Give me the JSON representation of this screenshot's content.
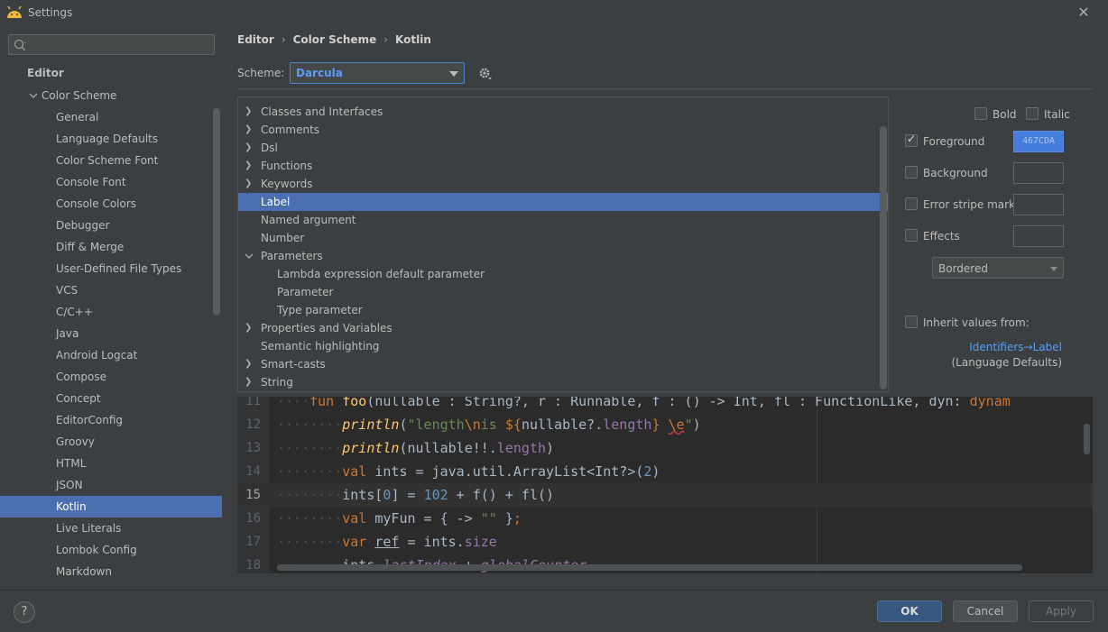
{
  "window": {
    "title": "Settings"
  },
  "search": {
    "placeholder": "",
    "value": ""
  },
  "sidebar": {
    "items": [
      {
        "label": "Editor",
        "level": 0
      },
      {
        "label": "Color Scheme",
        "level": 1,
        "expanded": true
      },
      {
        "label": "General",
        "level": 2
      },
      {
        "label": "Language Defaults",
        "level": 2
      },
      {
        "label": "Color Scheme Font",
        "level": 2
      },
      {
        "label": "Console Font",
        "level": 2
      },
      {
        "label": "Console Colors",
        "level": 2
      },
      {
        "label": "Debugger",
        "level": 2
      },
      {
        "label": "Diff & Merge",
        "level": 2
      },
      {
        "label": "User-Defined File Types",
        "level": 2
      },
      {
        "label": "VCS",
        "level": 2
      },
      {
        "label": "C/C++",
        "level": 2
      },
      {
        "label": "Java",
        "level": 2
      },
      {
        "label": "Android Logcat",
        "level": 2
      },
      {
        "label": "Compose",
        "level": 2
      },
      {
        "label": "Concept",
        "level": 2
      },
      {
        "label": "EditorConfig",
        "level": 2
      },
      {
        "label": "Groovy",
        "level": 2
      },
      {
        "label": "HTML",
        "level": 2
      },
      {
        "label": "JSON",
        "level": 2
      },
      {
        "label": "Kotlin",
        "level": 2,
        "selected": true
      },
      {
        "label": "Live Literals",
        "level": 2
      },
      {
        "label": "Lombok Config",
        "level": 2
      },
      {
        "label": "Markdown",
        "level": 2
      }
    ]
  },
  "breadcrumb": [
    "Editor",
    "Color Scheme",
    "Kotlin"
  ],
  "scheme": {
    "label": "Scheme:",
    "value": "Darcula"
  },
  "element_tree": [
    {
      "label": "Classes and Interfaces",
      "chevron": "right",
      "indent": 0
    },
    {
      "label": "Comments",
      "chevron": "right",
      "indent": 0
    },
    {
      "label": "Dsl",
      "chevron": "right",
      "indent": 0
    },
    {
      "label": "Functions",
      "chevron": "right",
      "indent": 0
    },
    {
      "label": "Keywords",
      "chevron": "right",
      "indent": 0
    },
    {
      "label": "Label",
      "chevron": "",
      "indent": 0,
      "selected": true
    },
    {
      "label": "Named argument",
      "chevron": "",
      "indent": 0
    },
    {
      "label": "Number",
      "chevron": "",
      "indent": 0
    },
    {
      "label": "Parameters",
      "chevron": "down",
      "indent": 0
    },
    {
      "label": "Lambda expression default parameter",
      "chevron": "",
      "indent": 1
    },
    {
      "label": "Parameter",
      "chevron": "",
      "indent": 1
    },
    {
      "label": "Type parameter",
      "chevron": "",
      "indent": 1
    },
    {
      "label": "Properties and Variables",
      "chevron": "right",
      "indent": 0
    },
    {
      "label": "Semantic highlighting",
      "chevron": "",
      "indent": 0
    },
    {
      "label": "Smart-casts",
      "chevron": "right",
      "indent": 0
    },
    {
      "label": "String",
      "chevron": "right",
      "indent": 0
    }
  ],
  "attributes": {
    "bold": {
      "label": "Bold",
      "checked": false
    },
    "italic": {
      "label": "Italic",
      "checked": false
    },
    "foreground": {
      "label": "Foreground",
      "checked": true,
      "color": "467CDA"
    },
    "background": {
      "label": "Background",
      "checked": false
    },
    "error_stripe": {
      "label": "Error stripe mark",
      "checked": false
    },
    "effects": {
      "label": "Effects",
      "checked": false,
      "style": "Bordered"
    },
    "inherit": {
      "label": "Inherit values from:",
      "checked": false,
      "link": "Identifiers→Label",
      "sub": "(Language Defaults)"
    }
  },
  "code_preview": {
    "line_numbers": [
      "11",
      "12",
      "13",
      "14",
      "15",
      "16",
      "17",
      "18"
    ],
    "current_line": "15"
  },
  "buttons": {
    "ok": "OK",
    "cancel": "Cancel",
    "apply": "Apply",
    "help": "?"
  },
  "colors": {
    "selection": "#4b6eaf",
    "link": "#589df6",
    "foreground_swatch": "#467cda"
  }
}
